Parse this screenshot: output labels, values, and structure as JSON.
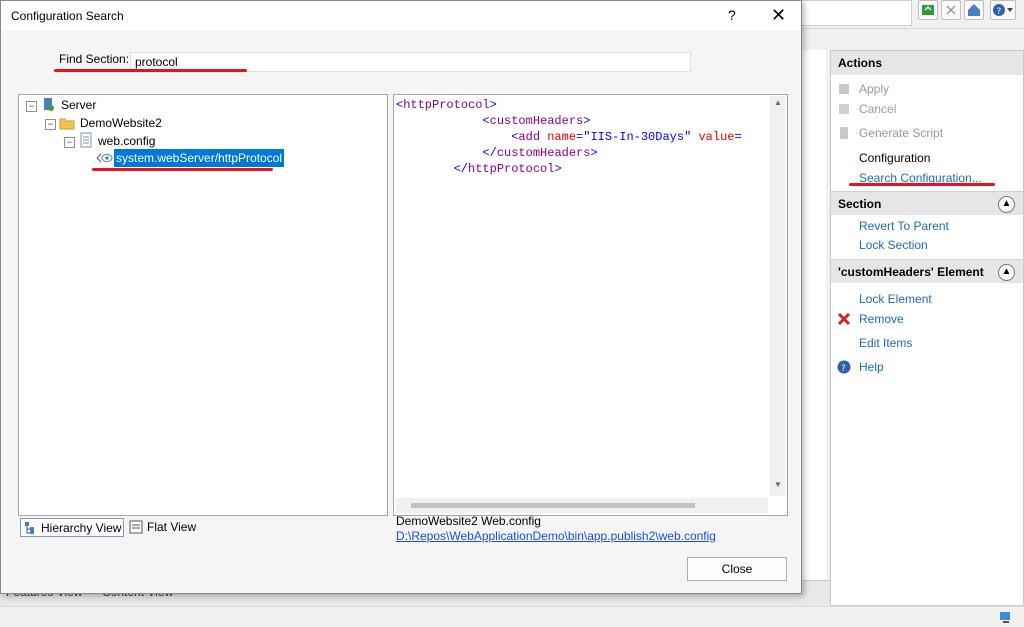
{
  "dialog": {
    "title": "Configuration Search",
    "help_label": "?",
    "close_glyph": "✕",
    "find_label": "Find Section:",
    "find_value": "protocol",
    "close_button": "Close"
  },
  "tree": {
    "nodes": [
      {
        "label": "Server",
        "icon": "server-icon"
      },
      {
        "label": "DemoWebsite2",
        "icon": "folder-icon"
      },
      {
        "label": "web.config",
        "icon": "config-file-icon"
      },
      {
        "label": "system.webServer/httpProtocol",
        "icon": "section-icon",
        "selected": true
      }
    ]
  },
  "code": {
    "lines": [
      {
        "indent": "",
        "parts": [
          [
            "brk",
            "<"
          ],
          [
            "tag",
            "httpProtocol"
          ],
          [
            "brk",
            ">"
          ]
        ]
      },
      {
        "indent": "            ",
        "parts": [
          [
            "brk",
            "<"
          ],
          [
            "tag",
            "customHeaders"
          ],
          [
            "brk",
            ">"
          ]
        ]
      },
      {
        "indent": "                ",
        "parts": [
          [
            "brk",
            "<"
          ],
          [
            "tag",
            "add "
          ],
          [
            "attr",
            "name"
          ],
          [
            "brk",
            "="
          ],
          [
            "val",
            "\"IIS-In-30Days\""
          ],
          [
            "tag",
            " "
          ],
          [
            "attr",
            "value"
          ],
          [
            "brk",
            "="
          ]
        ]
      },
      {
        "indent": "            ",
        "parts": [
          [
            "brk",
            "</"
          ],
          [
            "tag",
            "customHeaders"
          ],
          [
            "brk",
            ">"
          ]
        ]
      },
      {
        "indent": "        ",
        "parts": [
          [
            "brk",
            "</"
          ],
          [
            "tag",
            "httpProtocol"
          ],
          [
            "brk",
            ">"
          ]
        ]
      }
    ]
  },
  "view_tabs": {
    "hierarchy": "Hierarchy View",
    "flat": "Flat View"
  },
  "location": {
    "title": "DemoWebsite2 Web.config",
    "path": "D:\\Repos\\WebApplicationDemo\\bin\\app.publish2\\web.config"
  },
  "actions": {
    "header": "Actions",
    "top_items": [
      {
        "label": "Apply",
        "state": "disabled"
      },
      {
        "label": "Cancel",
        "state": "disabled"
      },
      {
        "label": "Generate Script",
        "state": "disabled"
      }
    ],
    "configuration_label": "Configuration",
    "search_configuration": "Search Configuration...",
    "section_header": "Section",
    "section_items": [
      "Revert To Parent",
      "Lock Section"
    ],
    "element_header": "'customHeaders' Element",
    "element_items": [
      "Lock Element",
      "Remove",
      "Edit Items"
    ],
    "help": "Help"
  },
  "background": {
    "bottom_tabs": [
      "Features View",
      "Content View"
    ]
  },
  "colors": {
    "accent_link": "#1e6bb8",
    "highlight": "#e8121b",
    "selection": "#0078d7"
  }
}
